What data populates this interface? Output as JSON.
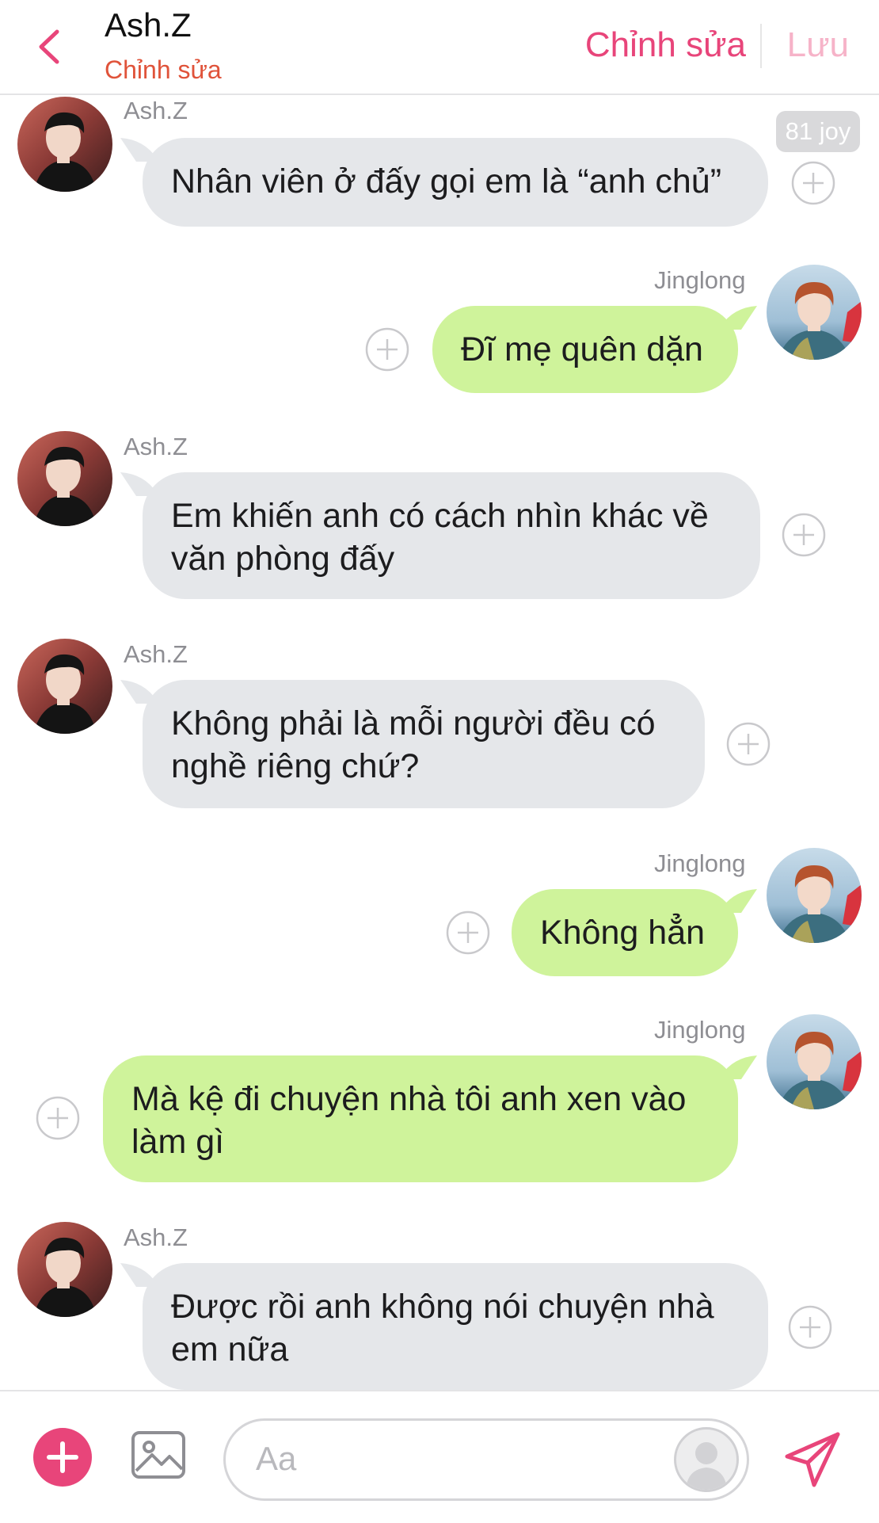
{
  "header": {
    "title": "Ash.Z",
    "subtitle": "Chỉnh sửa",
    "edit_label": "Chỉnh sửa",
    "save_label": "Lưu",
    "back_icon": "chevron-left-icon"
  },
  "messages": [
    {
      "sender": "Ash.Z",
      "side": "left",
      "text": "Nhân viên ở đấy gọi em là “anh chủ”",
      "badge": "81 joy"
    },
    {
      "sender": "Jinglong",
      "side": "right",
      "text": "Đĩ mẹ quên dặn"
    },
    {
      "sender": "Ash.Z",
      "side": "left",
      "lines": [
        "Em khiến anh có cách nhìn khác về",
        "văn phòng đấy"
      ]
    },
    {
      "sender": "Ash.Z",
      "side": "left",
      "lines": [
        "Không phải là mỗi người đều có",
        "nghề riêng chứ?"
      ]
    },
    {
      "sender": "Jinglong",
      "side": "right",
      "text": "Không hẳn"
    },
    {
      "sender": "Jinglong",
      "side": "right",
      "lines": [
        "Mà kệ đi chuyện nhà tôi anh xen vào",
        "làm gì"
      ]
    },
    {
      "sender": "Ash.Z",
      "side": "left",
      "lines": [
        "Được rồi anh không nói chuyện nhà",
        "em nữa"
      ]
    }
  ],
  "composer": {
    "placeholder": "Aa",
    "add_icon": "plus-icon",
    "image_icon": "image-icon",
    "send_icon": "send-icon"
  },
  "colors": {
    "accent": "#e8457a",
    "subtitle": "#e0533a",
    "bubble_in": "#e5e7ea",
    "bubble_out": "#cff39b"
  }
}
